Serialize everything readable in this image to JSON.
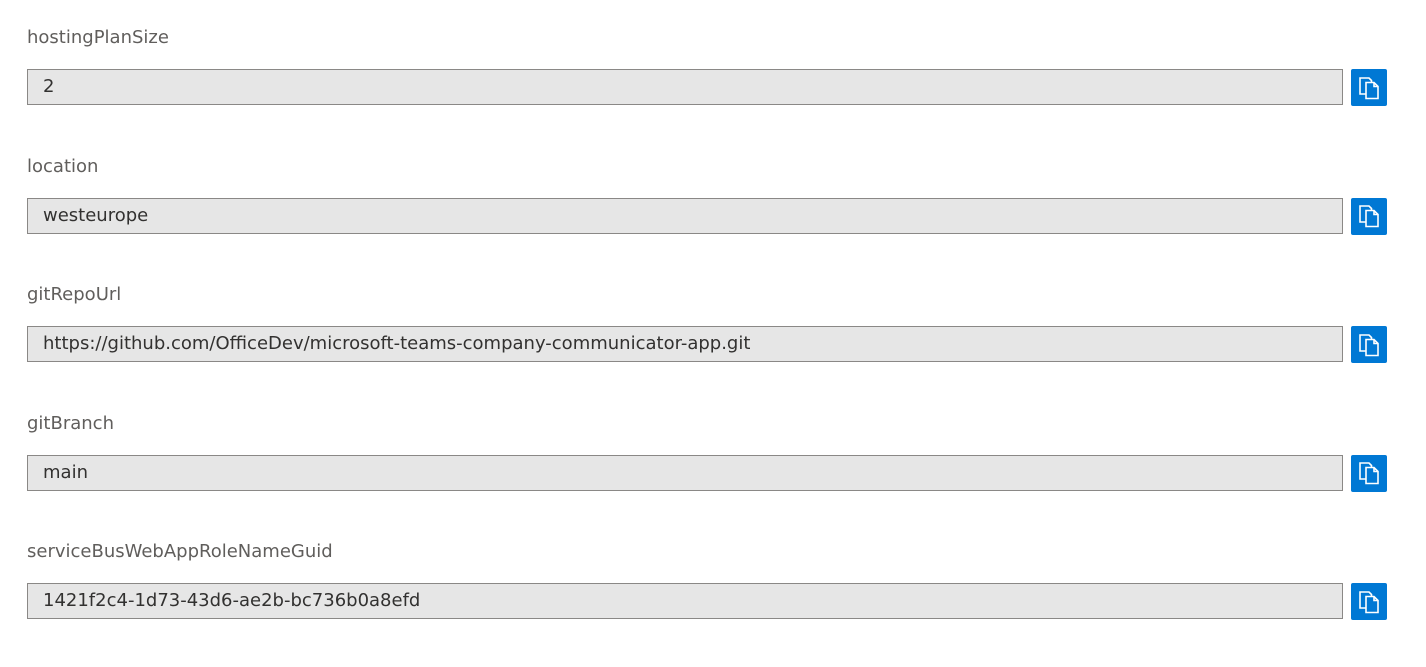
{
  "fields": [
    {
      "label": "hostingPlanSize",
      "value": "2",
      "copy_icon": "copy-icon"
    },
    {
      "label": "location",
      "value": "westeurope",
      "copy_icon": "copy-icon"
    },
    {
      "label": "gitRepoUrl",
      "value": "https://github.com/OfficeDev/microsoft-teams-company-communicator-app.git",
      "copy_icon": "copy-icon"
    },
    {
      "label": "gitBranch",
      "value": "main",
      "copy_icon": "copy-icon"
    },
    {
      "label": "serviceBusWebAppRoleNameGuid",
      "value": "1421f2c4-1d73-43d6-ae2b-bc736b0a8efd",
      "copy_icon": "copy-icon"
    }
  ],
  "colors": {
    "accent": "#0078d4",
    "field_background": "#e6e6e6",
    "field_border": "#8a8886",
    "label_text": "#605e5c"
  }
}
